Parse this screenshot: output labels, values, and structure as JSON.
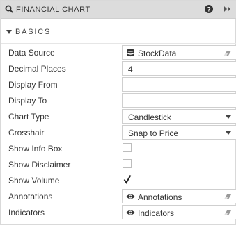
{
  "header": {
    "title": "FINANCIAL CHART",
    "icons": {
      "search": "search-icon",
      "help": "help-icon",
      "collapse": "double-chevron-right-icon"
    }
  },
  "section": {
    "title": "BASICS",
    "icon": "caret-down-icon"
  },
  "properties": {
    "data_source": {
      "label": "Data Source",
      "value": "StockData",
      "icon": "database-icon"
    },
    "decimal_places": {
      "label": "Decimal Places",
      "value": "4"
    },
    "display_from": {
      "label": "Display From",
      "value": ""
    },
    "display_to": {
      "label": "Display To",
      "value": ""
    },
    "chart_type": {
      "label": "Chart Type",
      "value": "Candlestick"
    },
    "crosshair": {
      "label": "Crosshair",
      "value": "Snap to Price"
    },
    "show_info_box": {
      "label": "Show Info Box",
      "checked": false
    },
    "show_disclaimer": {
      "label": "Show Disclaimer",
      "checked": false
    },
    "show_volume": {
      "label": "Show Volume",
      "checked": true
    },
    "annotations": {
      "label": "Annotations",
      "value": "Annotations",
      "icon": "eye-icon"
    },
    "indicators": {
      "label": "Indicators",
      "value": "Indicators",
      "icon": "eye-icon"
    }
  },
  "colors": {
    "header_bg": "#dcdcdc",
    "border": "#cfcfcf",
    "text": "#333333"
  }
}
